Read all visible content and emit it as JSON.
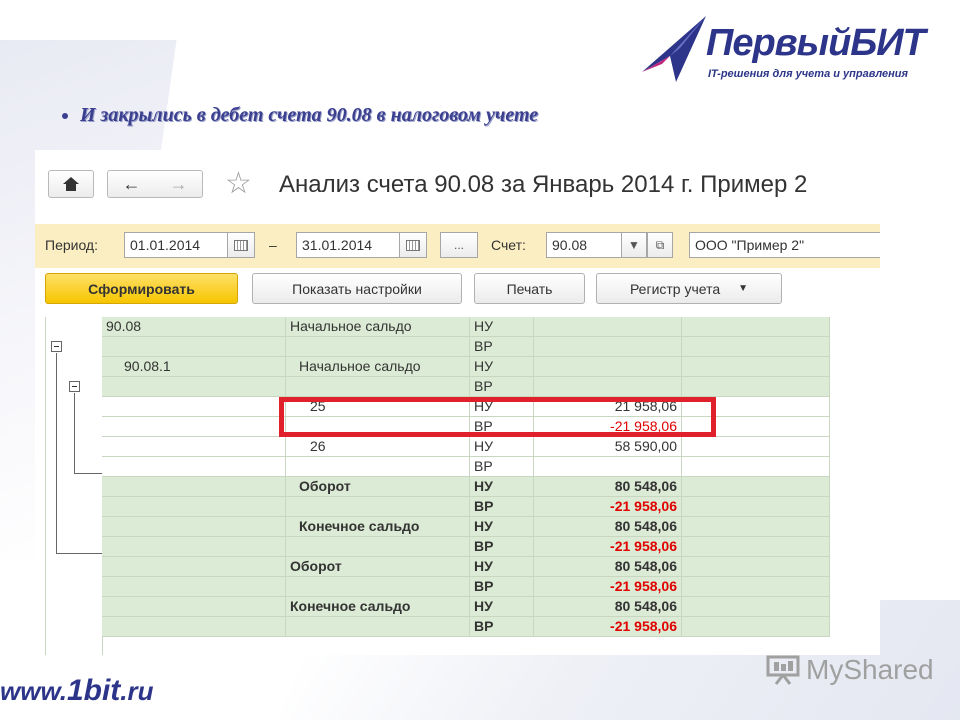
{
  "logo": {
    "title": "ПервыйБИТ",
    "subtitle": "IT-решения для учета и управления"
  },
  "heading": "И закрылись в дебет счета 90.08 в налоговом учете",
  "window": {
    "title": "Анализ счета 90.08 за Январь 2014 г. Пример 2"
  },
  "params": {
    "period_label": "Период:",
    "date_from": "01.01.2014",
    "dash": "–",
    "date_to": "31.01.2014",
    "more": "...",
    "account_label": "Счет:",
    "account": "90.08",
    "org": "ООО \"Пример 2\""
  },
  "commands": {
    "generate": "Сформировать",
    "show_settings": "Показать настройки",
    "print": "Печать",
    "register": "Регистр учета"
  },
  "report_rows": [
    {
      "acct": "90.08",
      "label": "Начальное сальдо",
      "type": "НУ",
      "value": "",
      "bold": false
    },
    {
      "acct": "",
      "label": "",
      "type": "ВР",
      "value": "",
      "bold": false
    },
    {
      "acct": "90.08.1",
      "label": "Начальное сальдо",
      "type": "НУ",
      "value": "",
      "bold": false
    },
    {
      "acct": "",
      "label": "",
      "type": "ВР",
      "value": "",
      "bold": false
    },
    {
      "acct": "",
      "label": "25",
      "type": "НУ",
      "value": "21 958,06",
      "bold": false
    },
    {
      "acct": "",
      "label": "",
      "type": "ВР",
      "value": "-21 958,06",
      "bold": false
    },
    {
      "acct": "",
      "label": "26",
      "type": "НУ",
      "value": "58 590,00",
      "bold": false
    },
    {
      "acct": "",
      "label": "",
      "type": "ВР",
      "value": "",
      "bold": false
    },
    {
      "acct": "",
      "label": "Оборот",
      "type": "НУ",
      "value": "80 548,06",
      "bold": true
    },
    {
      "acct": "",
      "label": "",
      "type": "ВР",
      "value": "-21 958,06",
      "bold": true
    },
    {
      "acct": "",
      "label": "Конечное сальдо",
      "type": "НУ",
      "value": "80 548,06",
      "bold": true
    },
    {
      "acct": "",
      "label": "",
      "type": "ВР",
      "value": "-21 958,06",
      "bold": true
    },
    {
      "acct": "",
      "label": "Оборот",
      "type": "НУ",
      "value": "80 548,06",
      "bold": true
    },
    {
      "acct": "",
      "label": "",
      "type": "ВР",
      "value": "-21 958,06",
      "bold": true
    },
    {
      "acct": "",
      "label": "Конечное сальдо",
      "type": "НУ",
      "value": "80 548,06",
      "bold": true
    },
    {
      "acct": "",
      "label": "",
      "type": "ВР",
      "value": "-21 958,06",
      "bold": true
    }
  ],
  "footer": {
    "url_prefix": "www.",
    "url_main": "1bit",
    "url_suffix": ".ru",
    "watermark": "MyShared"
  },
  "colors": {
    "brand": "#2c3589",
    "highlight": "#e0202a",
    "negative": "#e00000",
    "row_green": "#dcebd5",
    "params_bg": "#fbeec2",
    "primary_button": "#f6c500"
  }
}
